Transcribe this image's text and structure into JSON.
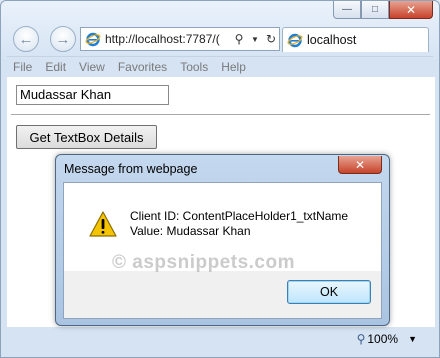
{
  "browser": {
    "address": "http://localhost:7787/(",
    "tab_title": "localhost",
    "menu": [
      "File",
      "Edit",
      "View",
      "Favorites",
      "Tools",
      "Help"
    ],
    "zoom": "100%"
  },
  "page": {
    "textbox_value": "Mudassar Khan",
    "button_label": "Get TextBox Details"
  },
  "dialog": {
    "title": "Message from webpage",
    "line1": "Client ID: ContentPlaceHolder1_txtName",
    "line2": "Value: Mudassar Khan",
    "ok_label": "OK"
  },
  "watermark": "© aspsnippets.com",
  "icons": {
    "back": "back-arrow-icon",
    "forward": "forward-arrow-icon",
    "site": "ie-logo-icon",
    "search": "search-icon",
    "refresh": "refresh-icon",
    "warning": "warning-icon",
    "zoom": "zoom-icon"
  }
}
